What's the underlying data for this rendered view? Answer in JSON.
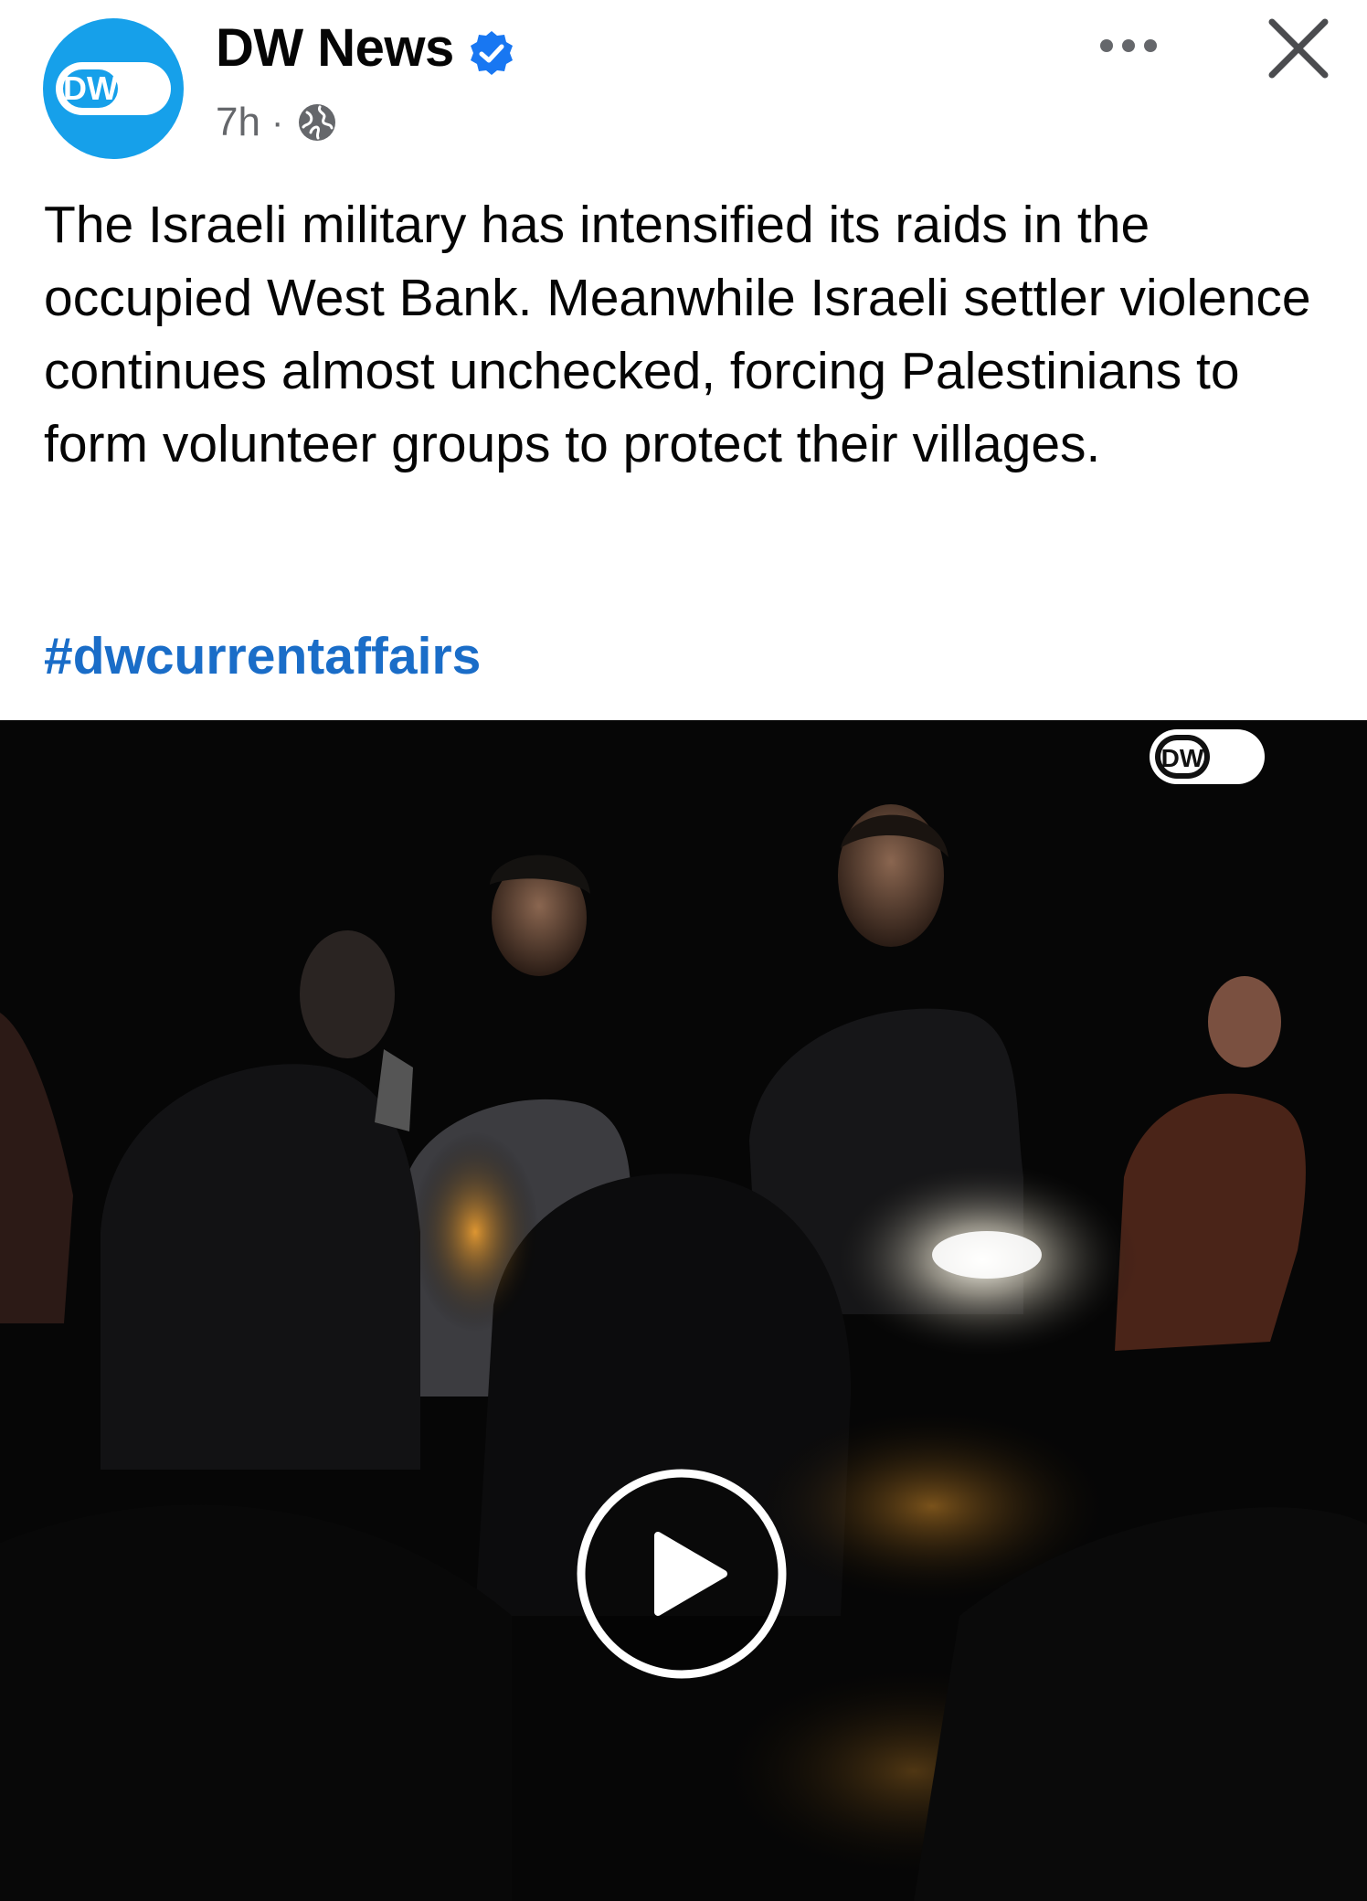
{
  "header": {
    "page_name": "DW News",
    "time_ago": "7h",
    "separator": "·",
    "avatar_logo_text": "DW",
    "verified_icon": "verified-badge-icon",
    "audience_icon": "globe-icon",
    "more_icon": "more-options-icon",
    "close_icon": "close-icon"
  },
  "post": {
    "text": "The Israeli military has intensified its raids in the occupied West Bank. Meanwhile Israeli settler violence continues almost unchecked, forcing Palestinians to form volunteer groups to protect their villages.",
    "hashtag": "#dwcurrentaffairs"
  },
  "video": {
    "watermark_text": "DW",
    "play_icon": "play-icon"
  },
  "colors": {
    "brand": "#16a0ea",
    "link": "#1a6dc8",
    "text": "#050505",
    "muted": "#65676b",
    "video_bg": "#050505"
  }
}
